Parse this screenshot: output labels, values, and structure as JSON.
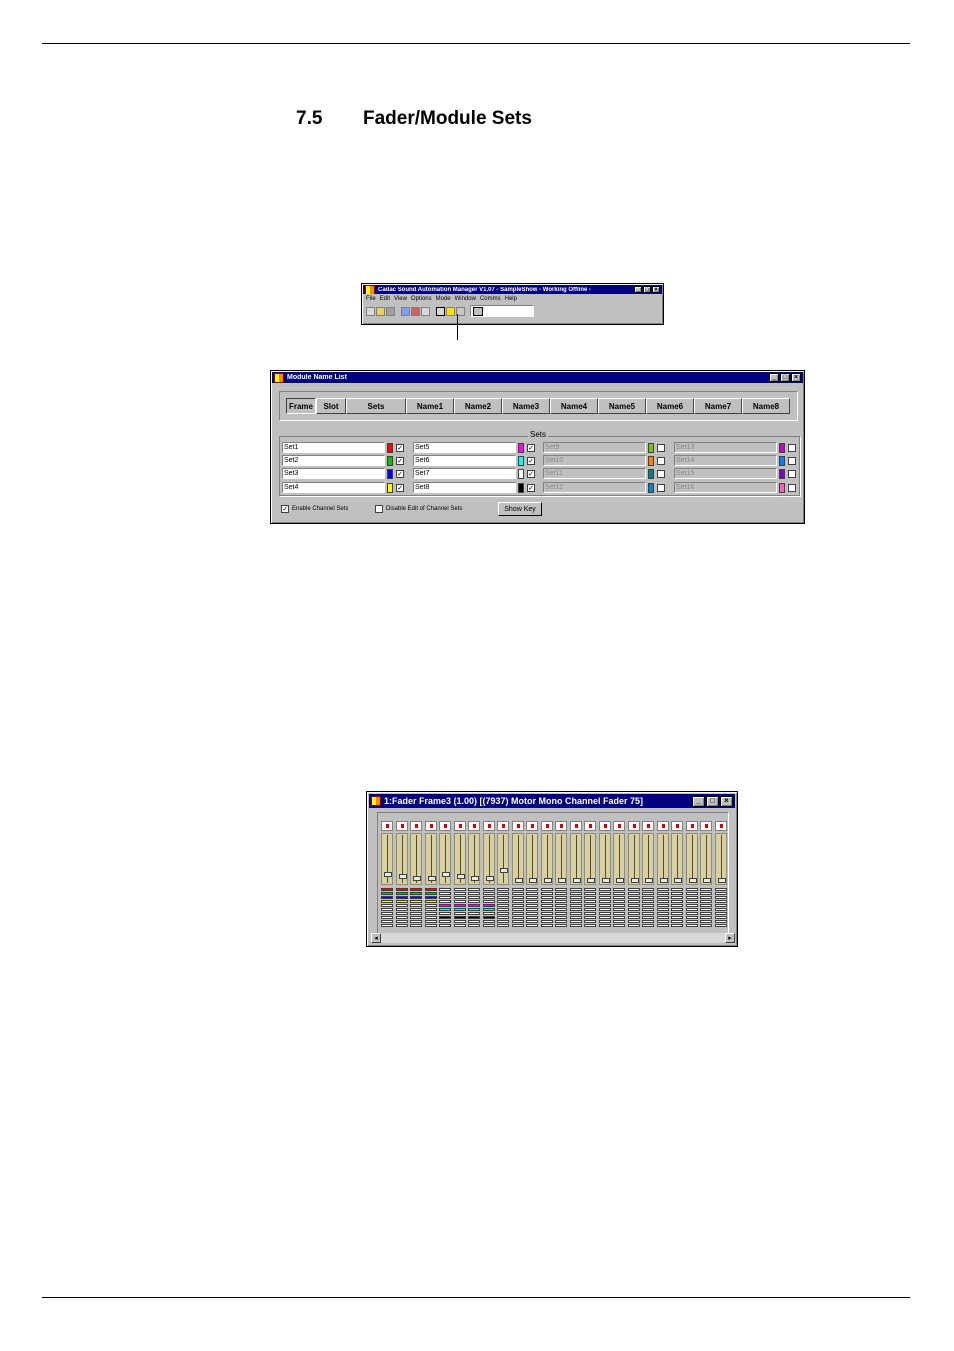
{
  "section": {
    "number": "7.5",
    "title": "Fader/Module Sets"
  },
  "app_window": {
    "title": "Cadac Sound Automation Manager V1.07  - SampleShow  - Working Offline -",
    "menus": [
      "File",
      "Edit",
      "View",
      "Options",
      "Mode",
      "Window",
      "Comms",
      "Help"
    ]
  },
  "module_name_list": {
    "title": "Module Name List",
    "columns": [
      "Frame",
      "Slot",
      "Sets",
      "Name1",
      "Name2",
      "Name3",
      "Name4",
      "Name5",
      "Name6",
      "Name7",
      "Name8"
    ],
    "sets_label": "Sets",
    "sets": [
      {
        "name": "Set1",
        "color": "#ff0000",
        "checked": true,
        "enabled": true
      },
      {
        "name": "Set2",
        "color": "#00c000",
        "checked": true,
        "enabled": true
      },
      {
        "name": "Set3",
        "color": "#0000ff",
        "checked": true,
        "enabled": true
      },
      {
        "name": "Set4",
        "color": "#ffff00",
        "checked": true,
        "enabled": true
      },
      {
        "name": "Set5",
        "color": "#ff00ff",
        "checked": true,
        "enabled": true
      },
      {
        "name": "Set6",
        "color": "#00ffff",
        "checked": true,
        "enabled": true
      },
      {
        "name": "Set7",
        "color": "#ffffff",
        "checked": true,
        "enabled": true
      },
      {
        "name": "Set8",
        "color": "#000000",
        "checked": true,
        "enabled": true
      },
      {
        "name": "Set9",
        "color": "#80c000",
        "checked": false,
        "enabled": false
      },
      {
        "name": "Set10",
        "color": "#ff8000",
        "checked": false,
        "enabled": false
      },
      {
        "name": "Set11",
        "color": "#008080",
        "checked": false,
        "enabled": false
      },
      {
        "name": "Set12",
        "color": "#0080c0",
        "checked": false,
        "enabled": false
      },
      {
        "name": "Set13",
        "color": "#c000c0",
        "checked": false,
        "enabled": false
      },
      {
        "name": "Set14",
        "color": "#0080ff",
        "checked": false,
        "enabled": false
      },
      {
        "name": "Set15",
        "color": "#8000c0",
        "checked": false,
        "enabled": false
      },
      {
        "name": "Set16",
        "color": "#ff60c0",
        "checked": false,
        "enabled": false
      }
    ],
    "enable_channel_sets": {
      "label": "Enable Channel Sets",
      "checked": true
    },
    "disable_edit_channel_sets": {
      "label": "Disable Edit of Channel Sets",
      "checked": false
    },
    "show_key_label": "Show Key"
  },
  "fader_frame": {
    "title": "1:Fader Frame3 (1.00)   [(7937) Motor Mono Channel Fader 75]"
  }
}
